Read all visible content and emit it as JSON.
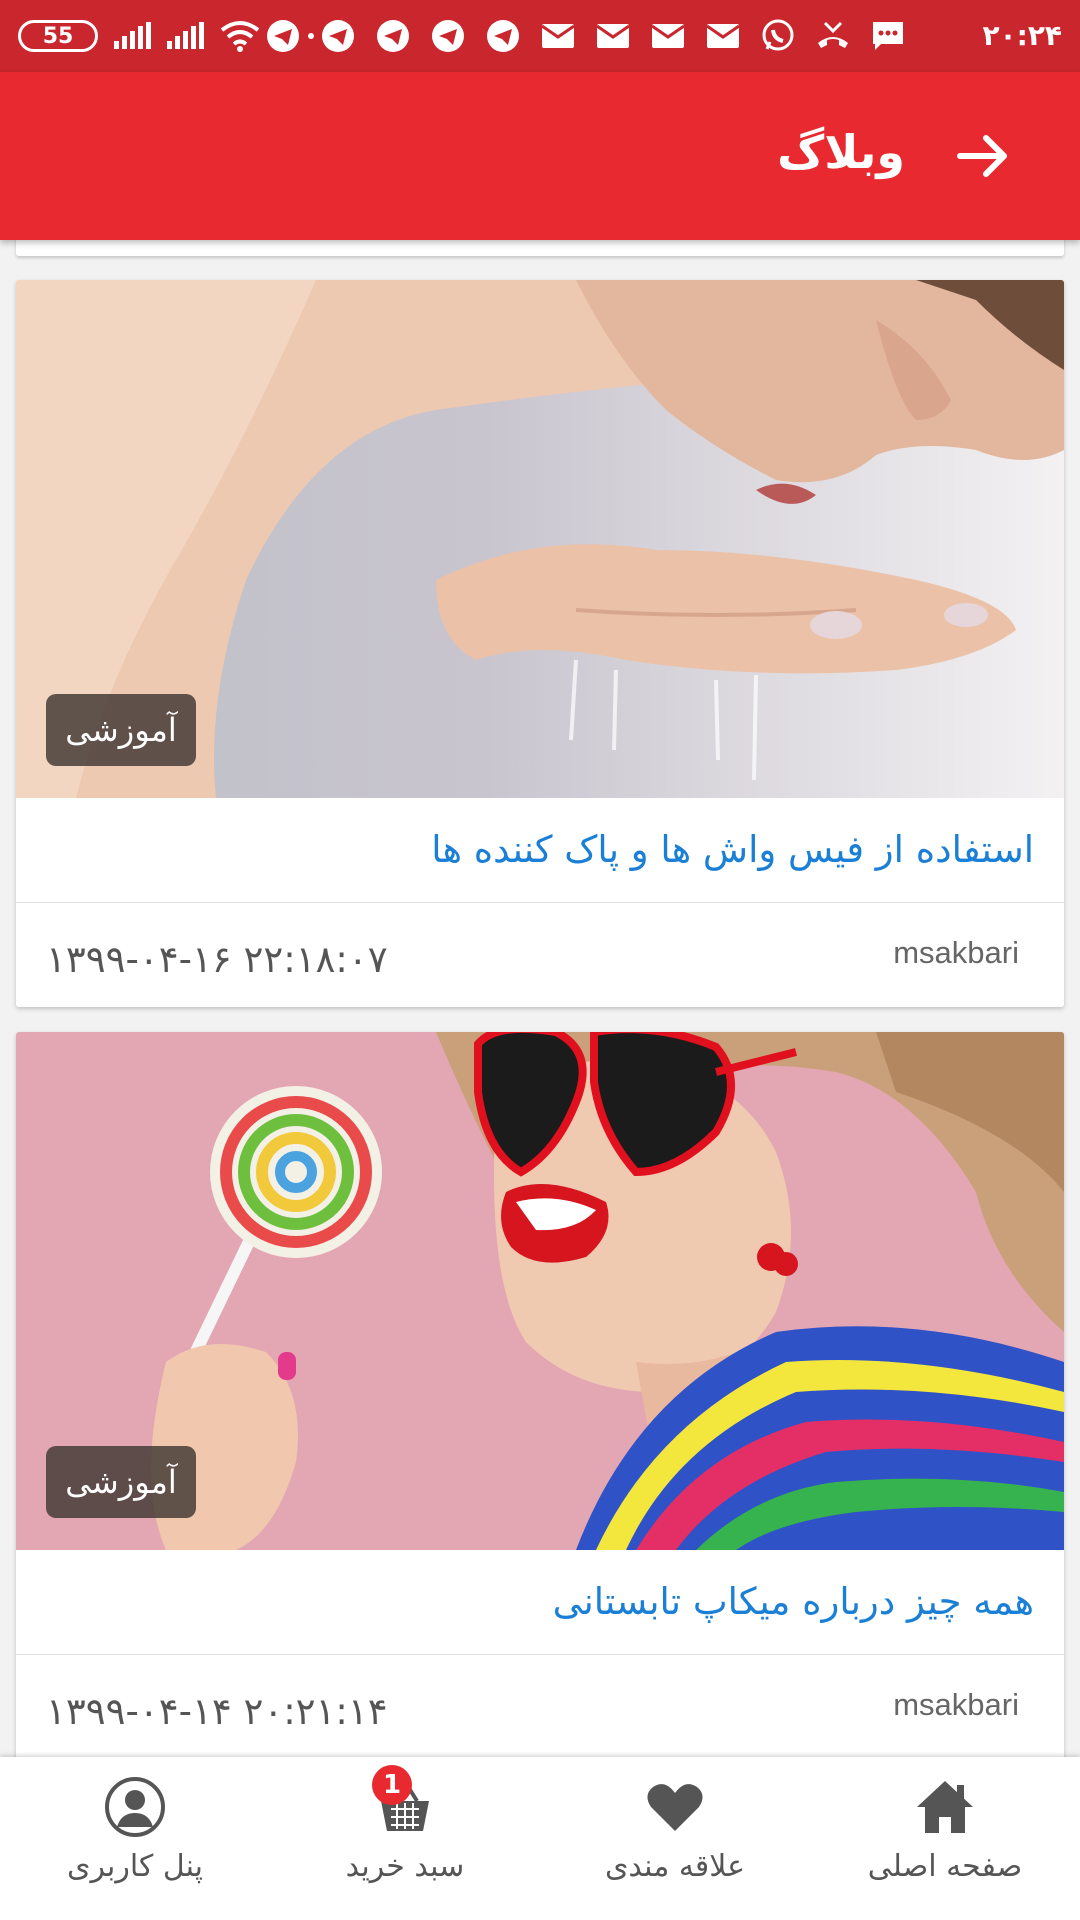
{
  "status_bar": {
    "battery": "55",
    "time": "۲۰:۲۴",
    "icons": [
      "telegram-icon",
      "telegram-icon",
      "telegram-icon",
      "telegram-icon",
      "telegram-icon",
      "mail-icon",
      "mail-icon",
      "mail-icon",
      "mail-icon",
      "whatsapp-icon",
      "missed-call-icon",
      "message-icon"
    ]
  },
  "app_bar": {
    "title": "وبلاگ",
    "back_icon": "arrow-right-icon",
    "color": "#e8292f"
  },
  "posts": [
    {
      "category": "آموزشی",
      "title": "استفاده از فیس واش ها و پاک کننده ها",
      "author": "msakbari",
      "date": "۱۳۹۹-۰۴-۱۶ ۲۲:۱۸:۰۷"
    },
    {
      "category": "آموزشی",
      "title": "همه چیز درباره میکاپ تابستانی",
      "author": "msakbari",
      "date": "۱۳۹۹-۰۴-۱۴ ۲۰:۲۱:۱۴"
    }
  ],
  "bottom_nav": {
    "profile": {
      "label": "پنل کاربری",
      "icon": "user-icon"
    },
    "cart": {
      "label": "سبد خرید",
      "icon": "basket-icon",
      "count": "1"
    },
    "favorites": {
      "label": "علاقه مندی",
      "icon": "heart-icon"
    },
    "home": {
      "label": "صفحه اصلی",
      "icon": "home-icon"
    }
  }
}
